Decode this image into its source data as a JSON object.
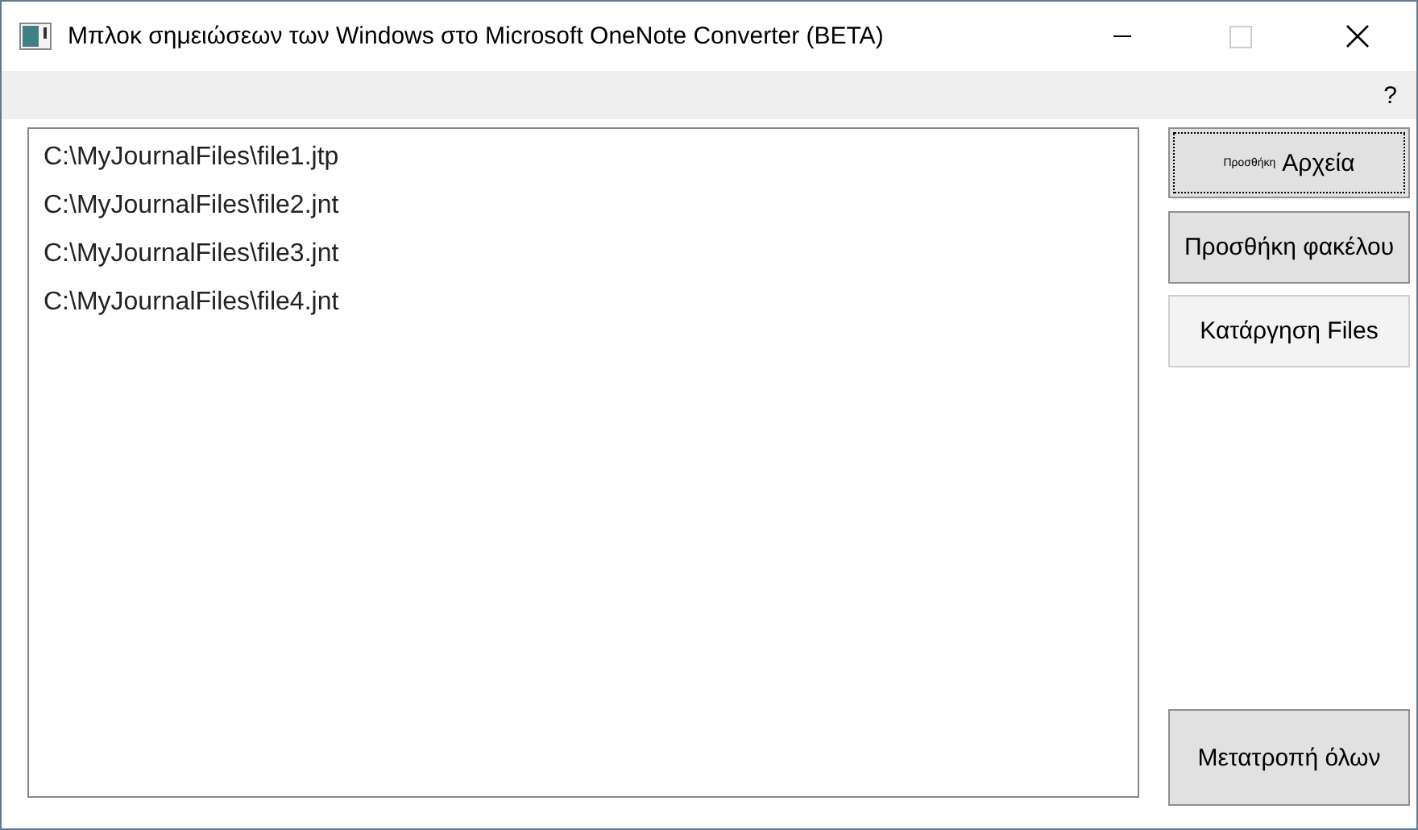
{
  "window": {
    "title": "Μπλοκ σημειώσεων των Windows στο Microsoft OneNote Converter (BETA)",
    "maximize_disabled": true
  },
  "menu": {
    "help": "?"
  },
  "files": [
    {
      "path": "C:\\MyJournalFiles\\file1.jtp"
    },
    {
      "path": "C:\\MyJournalFiles\\file2.jnt"
    },
    {
      "path": "C:\\MyJournalFiles\\file3.jnt"
    },
    {
      "path": "C:\\MyJournalFiles\\file4.jnt"
    }
  ],
  "buttons": [
    {
      "small_label": "Προσθήκη",
      "label": "Αρχεία",
      "kind": "raised",
      "focused": true
    },
    {
      "label": "Προσθήκη φακέλου",
      "kind": "raised",
      "focused": false
    },
    {
      "label": "Κατάργηση Files",
      "kind": "flat",
      "focused": false
    }
  ],
  "convert_button": {
    "label": "Μετατροπή όλων",
    "kind": "raised",
    "focused": false
  }
}
